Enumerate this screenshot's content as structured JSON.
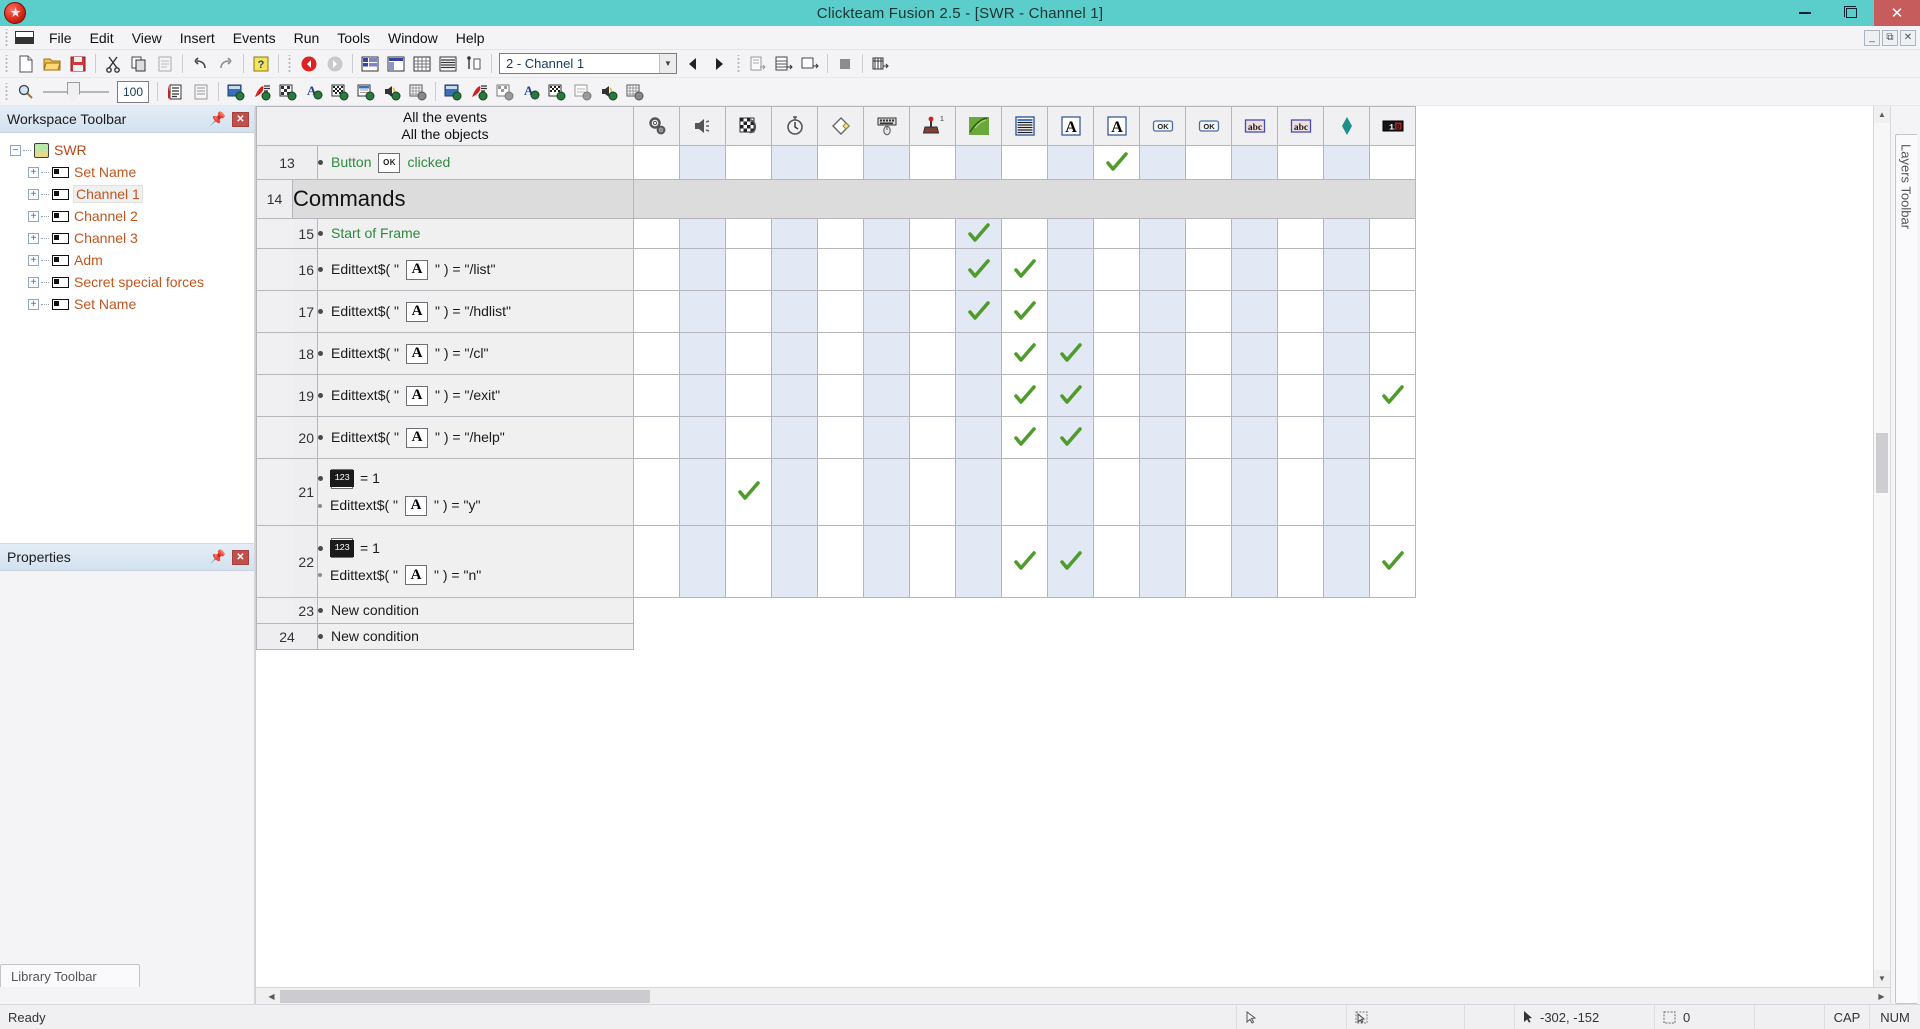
{
  "window": {
    "title": "Clickteam Fusion 2.5 - [SWR - Channel 1]",
    "app_icon": "clickteam-fusion-icon",
    "minimize": "—",
    "maximize": "❐",
    "close": "✕",
    "mdi_minimize": "—",
    "mdi_restore": "❐",
    "mdi_close": "✕"
  },
  "menubar": {
    "system_icon": "system-menu-icon",
    "items": [
      {
        "label": "File"
      },
      {
        "label": "Edit"
      },
      {
        "label": "View"
      },
      {
        "label": "Insert"
      },
      {
        "label": "Events"
      },
      {
        "label": "Run"
      },
      {
        "label": "Tools"
      },
      {
        "label": "Window"
      },
      {
        "label": "Help"
      }
    ]
  },
  "toolbar_main": {
    "groups": [
      {
        "buttons": [
          {
            "name": "new-file-icon",
            "glyph": "page"
          },
          {
            "name": "open-folder-icon",
            "glyph": "folder"
          },
          {
            "name": "save-icon",
            "glyph": "floppy"
          }
        ]
      },
      {
        "buttons": [
          {
            "name": "cut-icon",
            "glyph": "scissors"
          },
          {
            "name": "copy-icon",
            "glyph": "copy"
          },
          {
            "name": "paste-icon",
            "glyph": "paste"
          }
        ]
      },
      {
        "buttons": [
          {
            "name": "undo-icon",
            "glyph": "undo"
          },
          {
            "name": "redo-icon",
            "glyph": "redo"
          }
        ]
      },
      {
        "buttons": [
          {
            "name": "help-icon",
            "glyph": "question"
          }
        ]
      },
      {
        "buttons": [
          {
            "name": "back-icon",
            "glyph": "back"
          },
          {
            "name": "forward-icon",
            "glyph": "forward"
          }
        ]
      },
      {
        "buttons": [
          {
            "name": "storyboard-editor-icon",
            "glyph": "storyboard"
          },
          {
            "name": "frame-editor-icon",
            "glyph": "frame"
          },
          {
            "name": "event-editor-icon",
            "glyph": "eventgrid"
          },
          {
            "name": "event-list-editor-icon",
            "glyph": "eventlist"
          },
          {
            "name": "step-through-icon",
            "glyph": "stepthrough"
          }
        ]
      },
      {
        "buttons": [
          {
            "name": "prev-frame-icon",
            "glyph": "prev"
          },
          {
            "name": "next-frame-icon",
            "glyph": "next"
          }
        ]
      },
      {
        "buttons": [
          {
            "name": "insert-line-icon",
            "glyph": "insline"
          },
          {
            "name": "insert-group-icon",
            "glyph": "insgroup"
          },
          {
            "name": "insert-comment-icon",
            "glyph": "inscomment"
          }
        ]
      },
      {
        "buttons": [
          {
            "name": "stop-icon",
            "glyph": "stop"
          }
        ]
      },
      {
        "buttons": [
          {
            "name": "build-icon",
            "glyph": "build"
          }
        ]
      }
    ],
    "frame_selector": {
      "name": "frame-combo",
      "value": "2 - Channel 1",
      "dropdown_arrow": "▼"
    }
  },
  "toolbar_second": {
    "zoom_icon": "zoom-magnifier-icon",
    "zoom_value": "100",
    "buttons": [
      {
        "name": "event-list-view-icon"
      },
      {
        "name": "event-grid-view-icon"
      },
      {
        "name": "show-frame-objects-icon"
      },
      {
        "name": "show-active-objects-icon"
      },
      {
        "name": "show-backdrop-objects-icon"
      },
      {
        "name": "show-text-objects-icon"
      },
      {
        "name": "show-quick-backdrop-icon"
      },
      {
        "name": "show-system-objects-icon"
      },
      {
        "name": "show-sound-objects-icon"
      },
      {
        "name": "show-counter-objects-icon"
      },
      {
        "name": "filter-frame-objects-icon"
      },
      {
        "name": "filter-active-objects-icon"
      },
      {
        "name": "filter-backdrop-objects-icon"
      },
      {
        "name": "filter-text-objects-icon"
      },
      {
        "name": "filter-quick-backdrop-icon"
      },
      {
        "name": "filter-system-objects-icon"
      },
      {
        "name": "filter-sound-objects-icon"
      },
      {
        "name": "filter-counter-objects-icon"
      }
    ]
  },
  "workspace_panel": {
    "title": "Workspace Toolbar",
    "pin_icon": "pin-icon",
    "close_icon": "close-icon",
    "tree": [
      {
        "label": "SWR",
        "level": 0,
        "icon": "application-icon",
        "expander": "−",
        "selected": false
      },
      {
        "label": "Set Name",
        "level": 1,
        "icon": "frame-icon",
        "expander": "+",
        "selected": false
      },
      {
        "label": "Channel 1",
        "level": 1,
        "icon": "frame-icon",
        "expander": "+",
        "selected": true
      },
      {
        "label": "Channel 2",
        "level": 1,
        "icon": "frame-icon",
        "expander": "+",
        "selected": false
      },
      {
        "label": "Channel 3",
        "level": 1,
        "icon": "frame-icon",
        "expander": "+",
        "selected": false
      },
      {
        "label": "Adm",
        "level": 1,
        "icon": "frame-icon",
        "expander": "+",
        "selected": false
      },
      {
        "label": "Secret special forces",
        "level": 1,
        "icon": "frame-icon",
        "expander": "+",
        "selected": false
      },
      {
        "label": "Set Name",
        "level": 1,
        "icon": "frame-icon",
        "expander": "+",
        "selected": false
      }
    ]
  },
  "properties_panel": {
    "title": "Properties",
    "pin_icon": "pin-icon",
    "close_icon": "close-icon"
  },
  "library_tab": {
    "label": "Library Toolbar"
  },
  "layers_tab": {
    "label": "Layers Toolbar"
  },
  "event_editor": {
    "header": {
      "line1": "All the events",
      "line2": "All the objects"
    },
    "object_columns": [
      {
        "index": 0,
        "name": "special-conditions-column",
        "icon": "gears-icon"
      },
      {
        "index": 1,
        "name": "sound-object-column",
        "icon": "speaker-icon"
      },
      {
        "index": 2,
        "name": "storyboard-column",
        "icon": "checkerboard-flask-icon"
      },
      {
        "index": 3,
        "name": "timer-column",
        "icon": "stopwatch-icon"
      },
      {
        "index": 4,
        "name": "create-object-column",
        "icon": "diamond-outline-icon"
      },
      {
        "index": 5,
        "name": "mouse-keyboard-column",
        "icon": "keyboard-mouse-icon"
      },
      {
        "index": 6,
        "name": "player-1-column",
        "icon": "joystick-icon"
      },
      {
        "index": 7,
        "name": "active-object-column",
        "icon": "green-active-icon"
      },
      {
        "index": 8,
        "name": "list-object-column",
        "icon": "list-icon"
      },
      {
        "index": 9,
        "name": "text-object-a-column",
        "icon": "text-a-icon"
      },
      {
        "index": 10,
        "name": "text-object-b-column",
        "icon": "text-a-icon"
      },
      {
        "index": 11,
        "name": "button-ok-1-column",
        "icon": "button-ok-icon"
      },
      {
        "index": 12,
        "name": "button-ok-2-column",
        "icon": "button-ok-icon"
      },
      {
        "index": 13,
        "name": "edit-abc-1-column",
        "icon": "edit-abc-icon"
      },
      {
        "index": 14,
        "name": "edit-abc-2-column",
        "icon": "edit-abc-icon"
      },
      {
        "index": 15,
        "name": "diamond-object-column",
        "icon": "teal-diamond-icon"
      },
      {
        "index": 16,
        "name": "counter-object-column",
        "icon": "counter-digits-icon"
      }
    ],
    "rows": [
      {
        "number": "13",
        "type": "event",
        "indent": 0,
        "conditions": [
          {
            "parts": [
              {
                "kind": "text",
                "value": "Button",
                "color": "green"
              },
              {
                "kind": "thumb",
                "thumb": "button-ok-thumb",
                "label": "OK"
              },
              {
                "kind": "text",
                "value": "clicked",
                "color": "green"
              }
            ]
          }
        ],
        "checks": [
          11
        ]
      },
      {
        "number": "14",
        "type": "group",
        "title": "Commands",
        "checks": []
      },
      {
        "number": "15",
        "type": "event",
        "indent": 1,
        "conditions": [
          {
            "parts": [
              {
                "kind": "text",
                "value": "Start of Frame",
                "color": "green"
              }
            ]
          }
        ],
        "checks": [
          8
        ]
      },
      {
        "number": "16",
        "type": "event",
        "indent": 1,
        "conditions": [
          {
            "parts": [
              {
                "kind": "text",
                "value": "Edittext$( \"",
                "color": "black"
              },
              {
                "kind": "thumb",
                "thumb": "text-a-thumb",
                "label": "A"
              },
              {
                "kind": "text",
                "value": "\" ) = \"/list\"",
                "color": "black"
              }
            ]
          }
        ],
        "checks": [
          8,
          9
        ]
      },
      {
        "number": "17",
        "type": "event",
        "indent": 1,
        "conditions": [
          {
            "parts": [
              {
                "kind": "text",
                "value": "Edittext$( \"",
                "color": "black"
              },
              {
                "kind": "thumb",
                "thumb": "text-a-thumb",
                "label": "A"
              },
              {
                "kind": "text",
                "value": "\" ) = \"/hdlist\"",
                "color": "black"
              }
            ]
          }
        ],
        "checks": [
          8,
          9
        ]
      },
      {
        "number": "18",
        "type": "event",
        "indent": 1,
        "conditions": [
          {
            "parts": [
              {
                "kind": "text",
                "value": "Edittext$( \"",
                "color": "black"
              },
              {
                "kind": "thumb",
                "thumb": "text-a-thumb",
                "label": "A"
              },
              {
                "kind": "text",
                "value": "\" ) = \"/cl\"",
                "color": "black"
              }
            ]
          }
        ],
        "checks": [
          9,
          10
        ]
      },
      {
        "number": "19",
        "type": "event",
        "indent": 1,
        "conditions": [
          {
            "parts": [
              {
                "kind": "text",
                "value": "Edittext$( \"",
                "color": "black"
              },
              {
                "kind": "thumb",
                "thumb": "text-a-thumb",
                "label": "A"
              },
              {
                "kind": "text",
                "value": "\" ) = \"/exit\"",
                "color": "black"
              }
            ]
          }
        ],
        "checks": [
          9,
          10,
          16
        ]
      },
      {
        "number": "20",
        "type": "event",
        "indent": 1,
        "conditions": [
          {
            "parts": [
              {
                "kind": "text",
                "value": "Edittext$( \"",
                "color": "black"
              },
              {
                "kind": "thumb",
                "thumb": "text-a-thumb",
                "label": "A"
              },
              {
                "kind": "text",
                "value": "\" ) = \"/help\"",
                "color": "black"
              }
            ]
          }
        ],
        "checks": [
          9,
          10
        ]
      },
      {
        "number": "21",
        "type": "event",
        "indent": 1,
        "tall": true,
        "conditions": [
          {
            "parts": [
              {
                "kind": "thumb",
                "thumb": "counter-thumb",
                "label": "123"
              },
              {
                "kind": "text",
                "value": "= 1",
                "color": "black"
              }
            ]
          },
          {
            "sub": true,
            "parts": [
              {
                "kind": "text",
                "value": "Edittext$( \"",
                "color": "black"
              },
              {
                "kind": "thumb",
                "thumb": "text-a-thumb",
                "label": "A"
              },
              {
                "kind": "text",
                "value": "\" ) = \"y\"",
                "color": "black"
              }
            ]
          }
        ],
        "checks": [
          2
        ]
      },
      {
        "number": "22",
        "type": "event",
        "indent": 1,
        "tall": true,
        "conditions": [
          {
            "parts": [
              {
                "kind": "thumb",
                "thumb": "counter-thumb",
                "label": "123"
              },
              {
                "kind": "text",
                "value": "= 1",
                "color": "black"
              }
            ]
          },
          {
            "sub": true,
            "parts": [
              {
                "kind": "text",
                "value": "Edittext$( \"",
                "color": "black"
              },
              {
                "kind": "thumb",
                "thumb": "text-a-thumb",
                "label": "A"
              },
              {
                "kind": "text",
                "value": "\" ) = \"n\"",
                "color": "black"
              }
            ]
          }
        ],
        "checks": [
          9,
          10,
          16
        ]
      },
      {
        "number": "23",
        "type": "event",
        "indent": 1,
        "nogrid": true,
        "conditions": [
          {
            "parts": [
              {
                "kind": "text",
                "value": "New condition",
                "color": "black"
              }
            ]
          }
        ],
        "checks": []
      },
      {
        "number": "24",
        "type": "event",
        "indent": 0,
        "nogrid": true,
        "conditions": [
          {
            "parts": [
              {
                "kind": "text",
                "value": "New condition",
                "color": "black"
              }
            ]
          }
        ],
        "checks": []
      }
    ]
  },
  "statusbar": {
    "message": "Ready",
    "cursor_icon": "pointer-icon",
    "coordinates": "-302, -152",
    "selection_icon": "selection-icon",
    "selection_count": "0",
    "caps_lock": "CAP",
    "num_lock": "NUM",
    "grid_icon1": "arrow-select-icon",
    "grid_icon2": "marquee-select-icon"
  },
  "colors": {
    "title_bar": "#5bcdcb",
    "close_button": "#c75c5c",
    "check_green": "#4f9c2c",
    "tree_text": "#c0561f",
    "event_green": "#2d8a3e",
    "alt_column": "#e2e9f5",
    "group_row": "#dcdcdc"
  }
}
